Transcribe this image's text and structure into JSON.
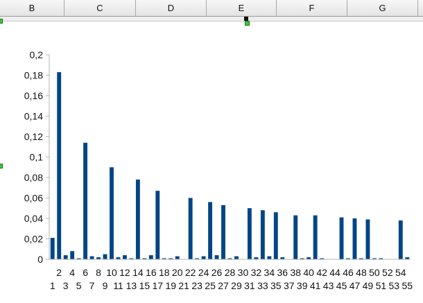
{
  "spreadsheet": {
    "columns": [
      "B",
      "C",
      "D",
      "E",
      "F",
      "G"
    ]
  },
  "chart_data": {
    "type": "bar",
    "title": "",
    "xlabel": "",
    "ylabel": "",
    "ylim": [
      0,
      0.2
    ],
    "yticks": [
      "0",
      "0,02",
      "0,04",
      "0,06",
      "0,08",
      "0,1",
      "0,12",
      "0,14",
      "0,16",
      "0,18",
      "0,2"
    ],
    "grid": false,
    "legend": "none",
    "bar_color": "#004586",
    "categories": [
      "1",
      "2",
      "3",
      "4",
      "5",
      "6",
      "7",
      "8",
      "9",
      "10",
      "11",
      "12",
      "13",
      "14",
      "15",
      "16",
      "17",
      "18",
      "19",
      "20",
      "21",
      "22",
      "23",
      "24",
      "25",
      "26",
      "27",
      "28",
      "29",
      "30",
      "31",
      "32",
      "33",
      "34",
      "35",
      "36",
      "37",
      "38",
      "39",
      "40",
      "41",
      "42",
      "43",
      "44",
      "45",
      "46",
      "47",
      "48",
      "49",
      "50",
      "51",
      "52",
      "53",
      "54",
      "55"
    ],
    "values": [
      0.021,
      0.183,
      0.004,
      0.008,
      0.001,
      0.114,
      0.003,
      0.002,
      0.005,
      0.09,
      0.002,
      0.004,
      0.001,
      0.078,
      0.001,
      0.004,
      0.067,
      0.001,
      0.001,
      0.003,
      0.0,
      0.06,
      0.001,
      0.003,
      0.056,
      0.004,
      0.053,
      0.001,
      0.003,
      0.0,
      0.05,
      0.002,
      0.048,
      0.003,
      0.046,
      0.002,
      0.0,
      0.043,
      0.001,
      0.002,
      0.043,
      0.001,
      0.0,
      0.0,
      0.041,
      0.001,
      0.04,
      0.001,
      0.039,
      0.001,
      0.001,
      0.0,
      0.0,
      0.038,
      0.002
    ]
  }
}
